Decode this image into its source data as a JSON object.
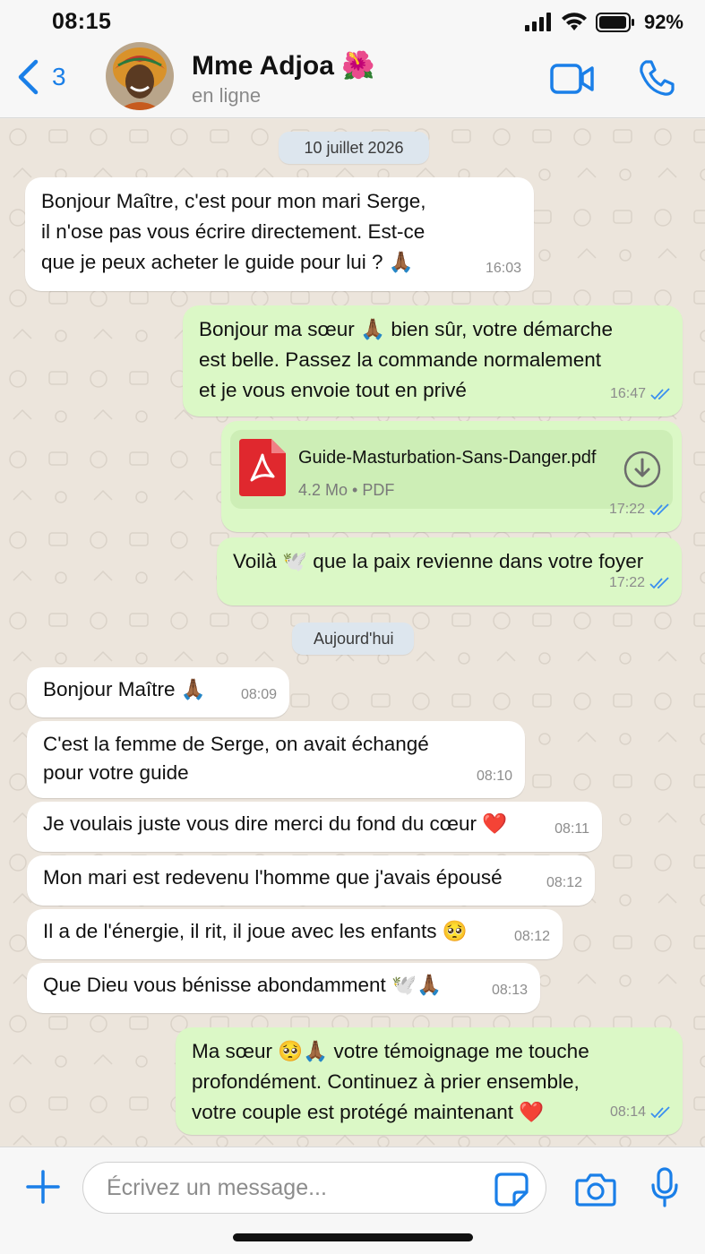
{
  "status_bar": {
    "time": "08:15",
    "battery_pct": "92%"
  },
  "header": {
    "back_count": "3",
    "contact_name": "Mme Adjoa 🌺",
    "contact_status": "en ligne"
  },
  "chat": {
    "date_1": "10 juillet 2026",
    "date_2": "Aujourd'hui",
    "messages": [
      {
        "dir": "in",
        "text": "Bonjour Maître, c'est pour mon mari Serge,\nil n'ose pas vous écrire directement. Est-ce\nque je peux acheter le guide pour lui ? 🙏🏾",
        "time": "16:03"
      },
      {
        "dir": "out",
        "text": "Bonjour ma sœur 🙏🏾 bien sûr, votre démarche\nest belle. Passez la commande normalement\net je vous envoie tout en privé",
        "time": "16:47"
      },
      {
        "dir": "out",
        "type": "file",
        "file_name": "Guide-Masturbation-Sans-Danger.pdf",
        "file_meta": "4.2 Mo • PDF",
        "time": "17:22"
      },
      {
        "dir": "out",
        "text": "Voilà 🕊️ que la paix revienne dans votre foyer",
        "time": "17:22"
      },
      {
        "dir": "in",
        "text": "Bonjour Maître 🙏🏾",
        "time": "08:09"
      },
      {
        "dir": "in",
        "text": "C'est la femme de Serge, on avait échangé\npour votre guide",
        "time": "08:10"
      },
      {
        "dir": "in",
        "text": "Je voulais juste vous dire merci du fond du cœur ❤️",
        "time": "08:11"
      },
      {
        "dir": "in",
        "text": "Mon mari est redevenu l'homme que j'avais épousé",
        "time": "08:12"
      },
      {
        "dir": "in",
        "text": "Il a de l'énergie, il rit, il joue avec les enfants 🥺",
        "time": "08:12"
      },
      {
        "dir": "in",
        "text": "Que Dieu vous bénisse abondamment 🕊️🙏🏾",
        "time": "08:13"
      },
      {
        "dir": "out",
        "text": "Ma sœur 🥺🙏🏾 votre témoignage me touche\nprofondément. Continuez à prier ensemble,\nvotre couple est protégé maintenant ❤️",
        "time": "08:14"
      }
    ]
  },
  "input": {
    "placeholder": "Écrivez un message..."
  },
  "colors": {
    "accent": "#1a7fe8",
    "out_bubble": "#dbf8c6",
    "in_bubble": "#ffffff",
    "read_ticks": "#3b8ff0",
    "pdf_red": "#e0282e"
  },
  "icons": [
    "back-chevron-icon",
    "video-call-icon",
    "phone-icon",
    "pdf-icon",
    "download-icon",
    "plus-icon",
    "sticker-icon",
    "camera-icon",
    "microphone-icon",
    "signal-icon",
    "wifi-icon",
    "battery-icon",
    "double-check-icon"
  ]
}
